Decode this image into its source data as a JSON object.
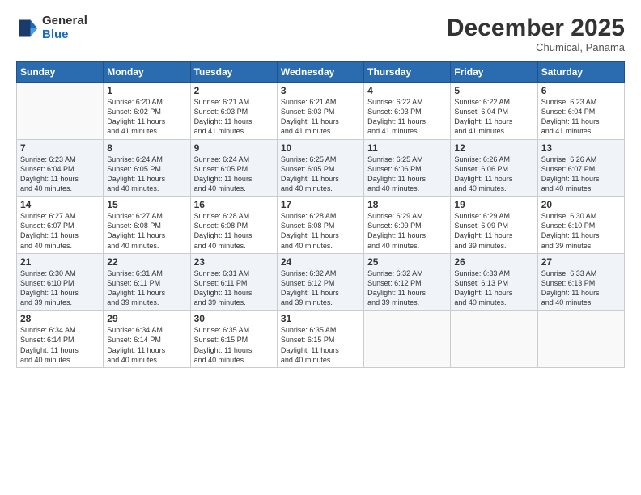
{
  "logo": {
    "general": "General",
    "blue": "Blue"
  },
  "header": {
    "month": "December 2025",
    "location": "Chumical, Panama"
  },
  "weekdays": [
    "Sunday",
    "Monday",
    "Tuesday",
    "Wednesday",
    "Thursday",
    "Friday",
    "Saturday"
  ],
  "weeks": [
    [
      {
        "day": "",
        "info": ""
      },
      {
        "day": "1",
        "info": "Sunrise: 6:20 AM\nSunset: 6:02 PM\nDaylight: 11 hours\nand 41 minutes."
      },
      {
        "day": "2",
        "info": "Sunrise: 6:21 AM\nSunset: 6:03 PM\nDaylight: 11 hours\nand 41 minutes."
      },
      {
        "day": "3",
        "info": "Sunrise: 6:21 AM\nSunset: 6:03 PM\nDaylight: 11 hours\nand 41 minutes."
      },
      {
        "day": "4",
        "info": "Sunrise: 6:22 AM\nSunset: 6:03 PM\nDaylight: 11 hours\nand 41 minutes."
      },
      {
        "day": "5",
        "info": "Sunrise: 6:22 AM\nSunset: 6:04 PM\nDaylight: 11 hours\nand 41 minutes."
      },
      {
        "day": "6",
        "info": "Sunrise: 6:23 AM\nSunset: 6:04 PM\nDaylight: 11 hours\nand 41 minutes."
      }
    ],
    [
      {
        "day": "7",
        "info": "Sunrise: 6:23 AM\nSunset: 6:04 PM\nDaylight: 11 hours\nand 40 minutes."
      },
      {
        "day": "8",
        "info": "Sunrise: 6:24 AM\nSunset: 6:05 PM\nDaylight: 11 hours\nand 40 minutes."
      },
      {
        "day": "9",
        "info": "Sunrise: 6:24 AM\nSunset: 6:05 PM\nDaylight: 11 hours\nand 40 minutes."
      },
      {
        "day": "10",
        "info": "Sunrise: 6:25 AM\nSunset: 6:05 PM\nDaylight: 11 hours\nand 40 minutes."
      },
      {
        "day": "11",
        "info": "Sunrise: 6:25 AM\nSunset: 6:06 PM\nDaylight: 11 hours\nand 40 minutes."
      },
      {
        "day": "12",
        "info": "Sunrise: 6:26 AM\nSunset: 6:06 PM\nDaylight: 11 hours\nand 40 minutes."
      },
      {
        "day": "13",
        "info": "Sunrise: 6:26 AM\nSunset: 6:07 PM\nDaylight: 11 hours\nand 40 minutes."
      }
    ],
    [
      {
        "day": "14",
        "info": "Sunrise: 6:27 AM\nSunset: 6:07 PM\nDaylight: 11 hours\nand 40 minutes."
      },
      {
        "day": "15",
        "info": "Sunrise: 6:27 AM\nSunset: 6:08 PM\nDaylight: 11 hours\nand 40 minutes."
      },
      {
        "day": "16",
        "info": "Sunrise: 6:28 AM\nSunset: 6:08 PM\nDaylight: 11 hours\nand 40 minutes."
      },
      {
        "day": "17",
        "info": "Sunrise: 6:28 AM\nSunset: 6:08 PM\nDaylight: 11 hours\nand 40 minutes."
      },
      {
        "day": "18",
        "info": "Sunrise: 6:29 AM\nSunset: 6:09 PM\nDaylight: 11 hours\nand 40 minutes."
      },
      {
        "day": "19",
        "info": "Sunrise: 6:29 AM\nSunset: 6:09 PM\nDaylight: 11 hours\nand 39 minutes."
      },
      {
        "day": "20",
        "info": "Sunrise: 6:30 AM\nSunset: 6:10 PM\nDaylight: 11 hours\nand 39 minutes."
      }
    ],
    [
      {
        "day": "21",
        "info": "Sunrise: 6:30 AM\nSunset: 6:10 PM\nDaylight: 11 hours\nand 39 minutes."
      },
      {
        "day": "22",
        "info": "Sunrise: 6:31 AM\nSunset: 6:11 PM\nDaylight: 11 hours\nand 39 minutes."
      },
      {
        "day": "23",
        "info": "Sunrise: 6:31 AM\nSunset: 6:11 PM\nDaylight: 11 hours\nand 39 minutes."
      },
      {
        "day": "24",
        "info": "Sunrise: 6:32 AM\nSunset: 6:12 PM\nDaylight: 11 hours\nand 39 minutes."
      },
      {
        "day": "25",
        "info": "Sunrise: 6:32 AM\nSunset: 6:12 PM\nDaylight: 11 hours\nand 39 minutes."
      },
      {
        "day": "26",
        "info": "Sunrise: 6:33 AM\nSunset: 6:13 PM\nDaylight: 11 hours\nand 40 minutes."
      },
      {
        "day": "27",
        "info": "Sunrise: 6:33 AM\nSunset: 6:13 PM\nDaylight: 11 hours\nand 40 minutes."
      }
    ],
    [
      {
        "day": "28",
        "info": "Sunrise: 6:34 AM\nSunset: 6:14 PM\nDaylight: 11 hours\nand 40 minutes."
      },
      {
        "day": "29",
        "info": "Sunrise: 6:34 AM\nSunset: 6:14 PM\nDaylight: 11 hours\nand 40 minutes."
      },
      {
        "day": "30",
        "info": "Sunrise: 6:35 AM\nSunset: 6:15 PM\nDaylight: 11 hours\nand 40 minutes."
      },
      {
        "day": "31",
        "info": "Sunrise: 6:35 AM\nSunset: 6:15 PM\nDaylight: 11 hours\nand 40 minutes."
      },
      {
        "day": "",
        "info": ""
      },
      {
        "day": "",
        "info": ""
      },
      {
        "day": "",
        "info": ""
      }
    ]
  ]
}
